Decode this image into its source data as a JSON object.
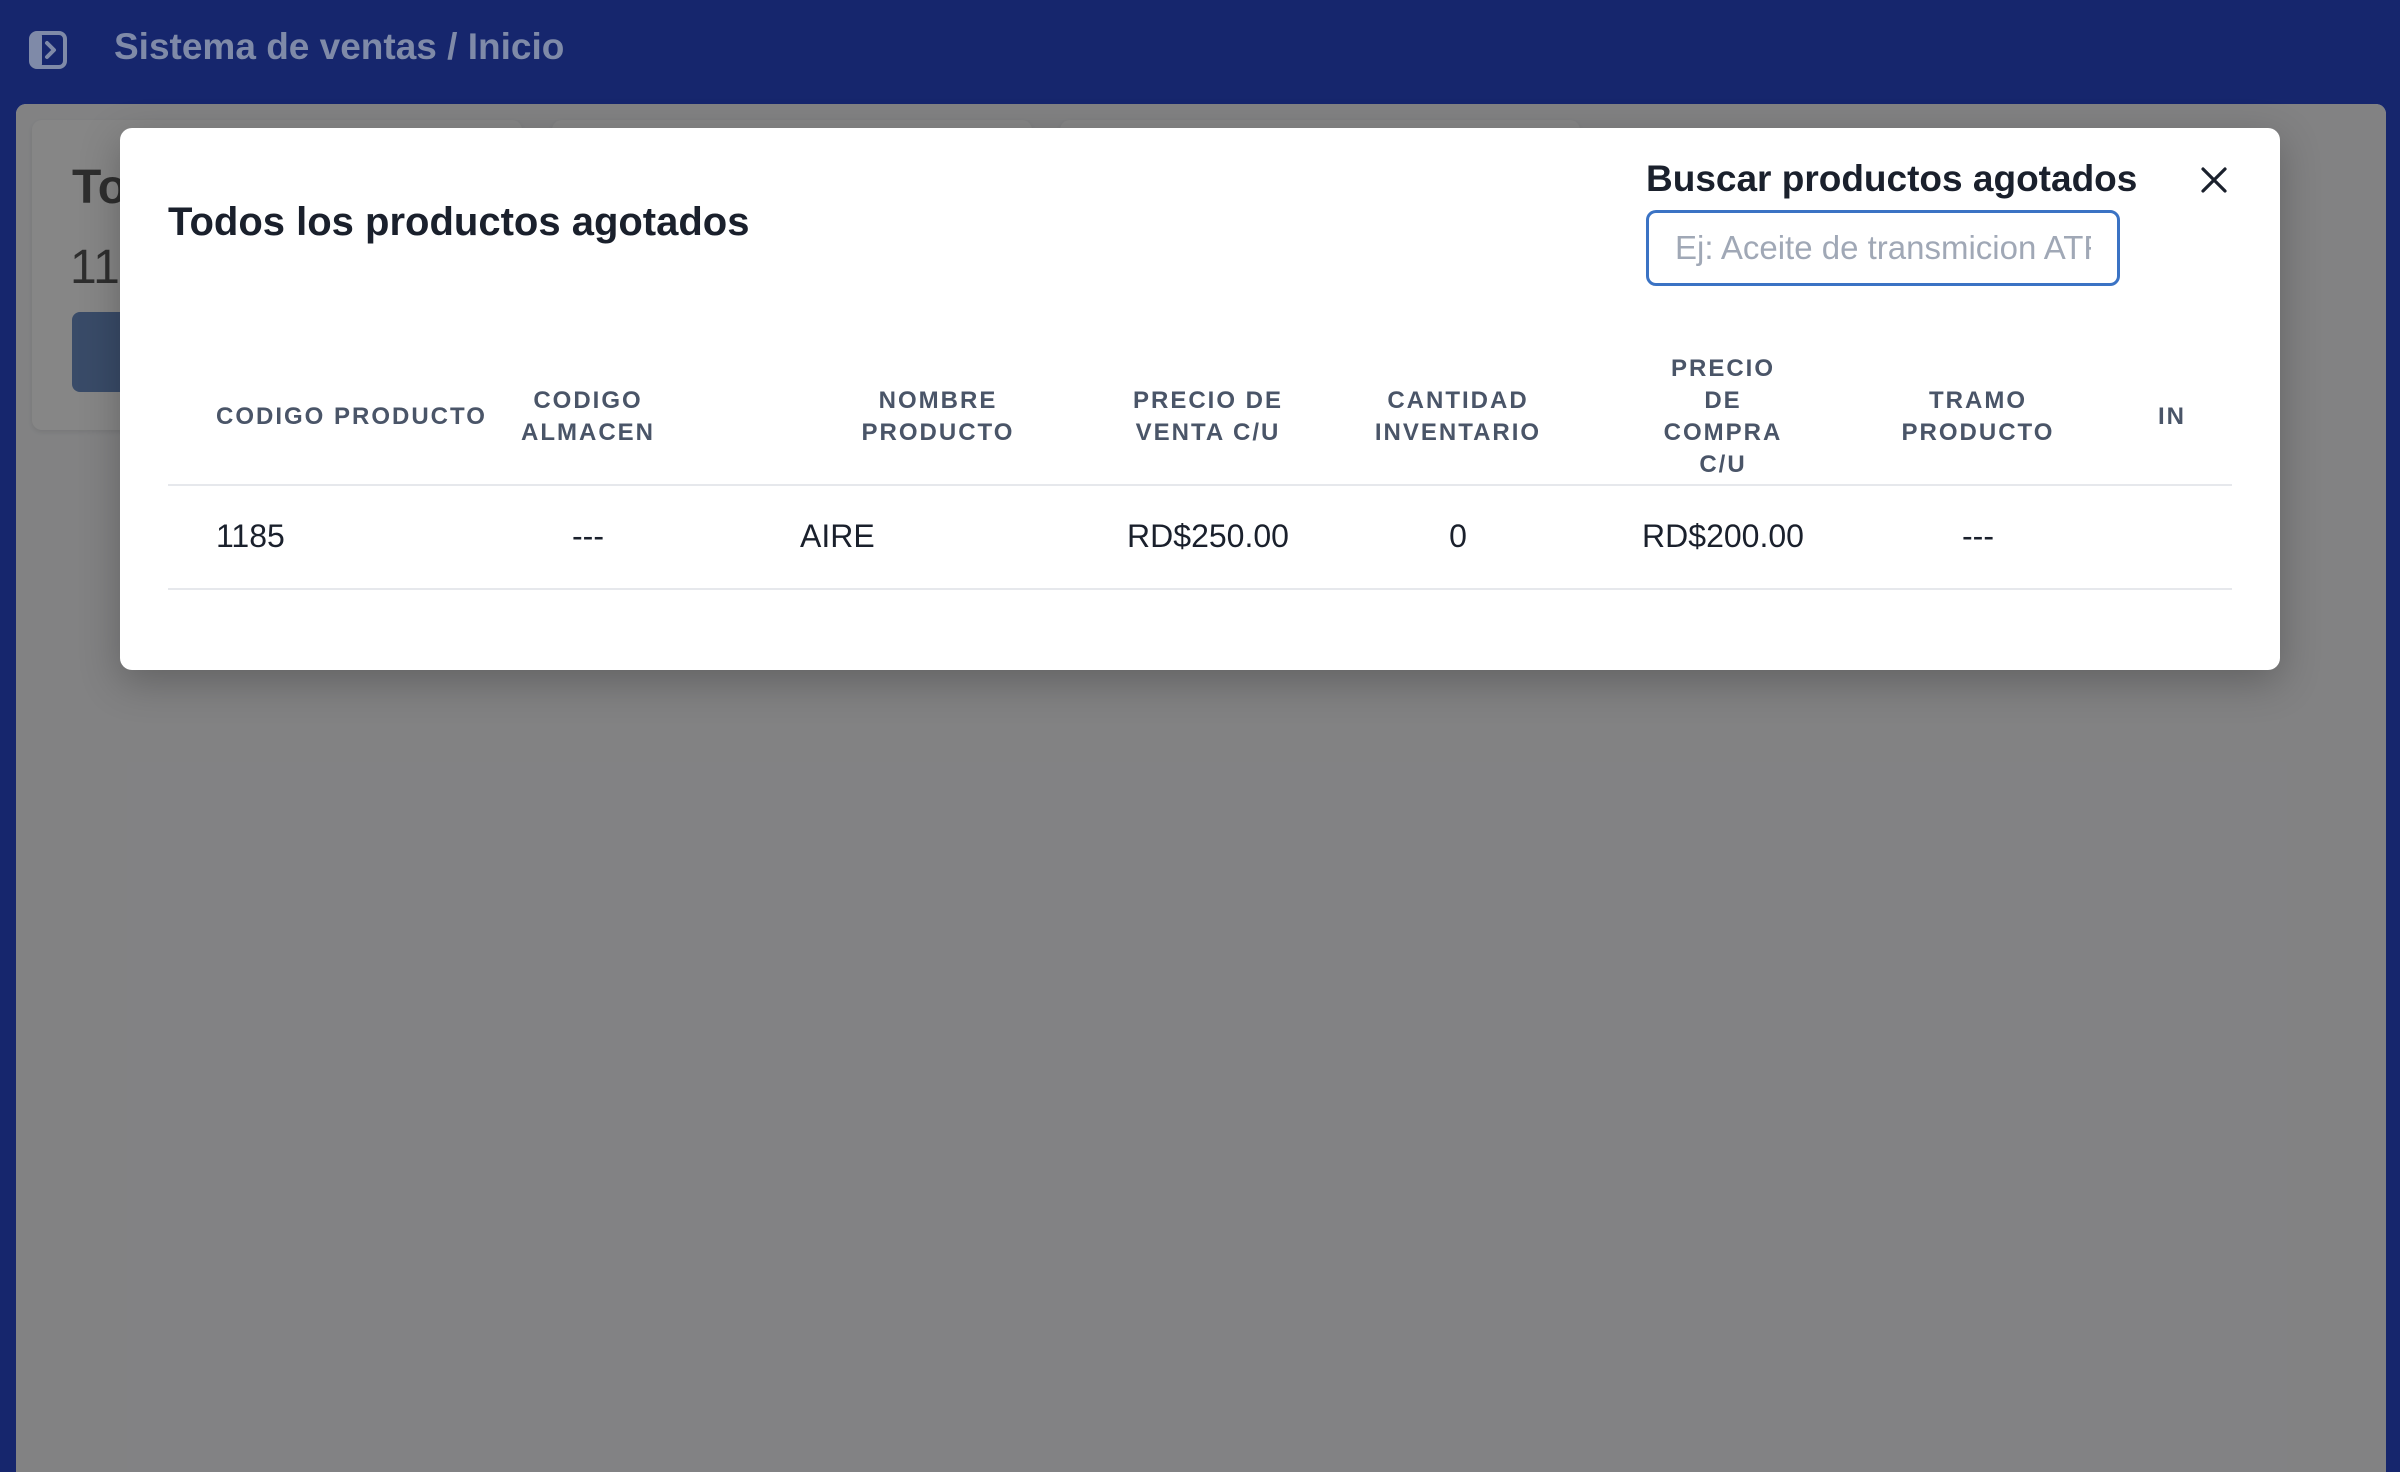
{
  "header": {
    "title": "Sistema de ventas / Inicio"
  },
  "background": {
    "card_title": "To",
    "card_value": "11"
  },
  "modal": {
    "title": "Todos los productos agotados",
    "search_label": "Buscar productos agotados",
    "search_placeholder": "Ej: Aceite de transmicion ATF",
    "search_value": "",
    "columns": [
      "CODIGO PRODUCTO",
      "CODIGO ALMACEN",
      "NOMBRE PRODUCTO",
      "PRECIO DE VENTA C/U",
      "CANTIDAD INVENTARIO",
      "PRECIO DE COMPRA C/U",
      "TRAMO PRODUCTO",
      "IN"
    ],
    "rows": [
      [
        "1185",
        "---",
        "AIRE",
        "RD$250.00",
        "0",
        "RD$200.00",
        "---",
        ""
      ]
    ]
  },
  "icons": {
    "sidebar_toggle": "sidebar-toggle-icon",
    "close": "close-icon"
  },
  "colors": {
    "topbar": "#16266d",
    "accent": "#3b73c4",
    "button": "#3565b0"
  }
}
